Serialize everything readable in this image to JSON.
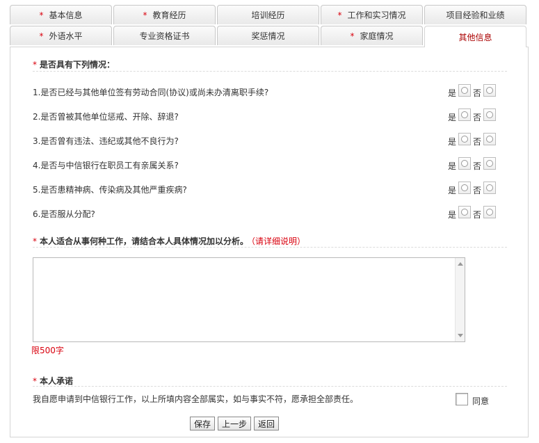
{
  "tabs": {
    "row1": [
      {
        "label": "基本信息",
        "required": true
      },
      {
        "label": "教育经历",
        "required": true
      },
      {
        "label": "培训经历",
        "required": false
      },
      {
        "label": "工作和实习情况",
        "required": true
      },
      {
        "label": "项目经验和业绩",
        "required": false
      }
    ],
    "row2": [
      {
        "label": "外语水平",
        "required": true
      },
      {
        "label": "专业资格证书",
        "required": false
      },
      {
        "label": "奖惩情况",
        "required": false
      },
      {
        "label": "家庭情况",
        "required": true
      },
      {
        "label": "其他信息",
        "required": false,
        "active": true
      }
    ]
  },
  "required_mark": "*",
  "section1": {
    "title": "是否具有下列情况："
  },
  "options": {
    "yes": "是",
    "no": "否"
  },
  "questions": [
    "1.是否已经与其他单位签有劳动合同(协议)或尚未办清离职手续?",
    "2.是否曾被其他单位惩戒、开除、辞退?",
    "3.是否曾有违法、违纪或其他不良行为?",
    "4.是否与中信银行在职员工有亲属关系?",
    "5.是否患精神病、传染病及其他严重疾病?",
    "6.是否服从分配?"
  ],
  "section2": {
    "title": "本人适合从事何种工作，请结合本人具体情况加以分析。",
    "note": "（请详细说明）"
  },
  "textarea_limit": "限500字",
  "section3": {
    "title": "本人承诺"
  },
  "promise_text": "我自愿申请到中信银行工作，以上所填内容全部属实，如与事实不符，愿承担全部责任。",
  "agree_label": "同意",
  "buttons": {
    "save": "保存",
    "prev": "上一步",
    "back": "返回"
  },
  "colors": {
    "required": "#d9000d",
    "active_tab": "#aa0000"
  }
}
